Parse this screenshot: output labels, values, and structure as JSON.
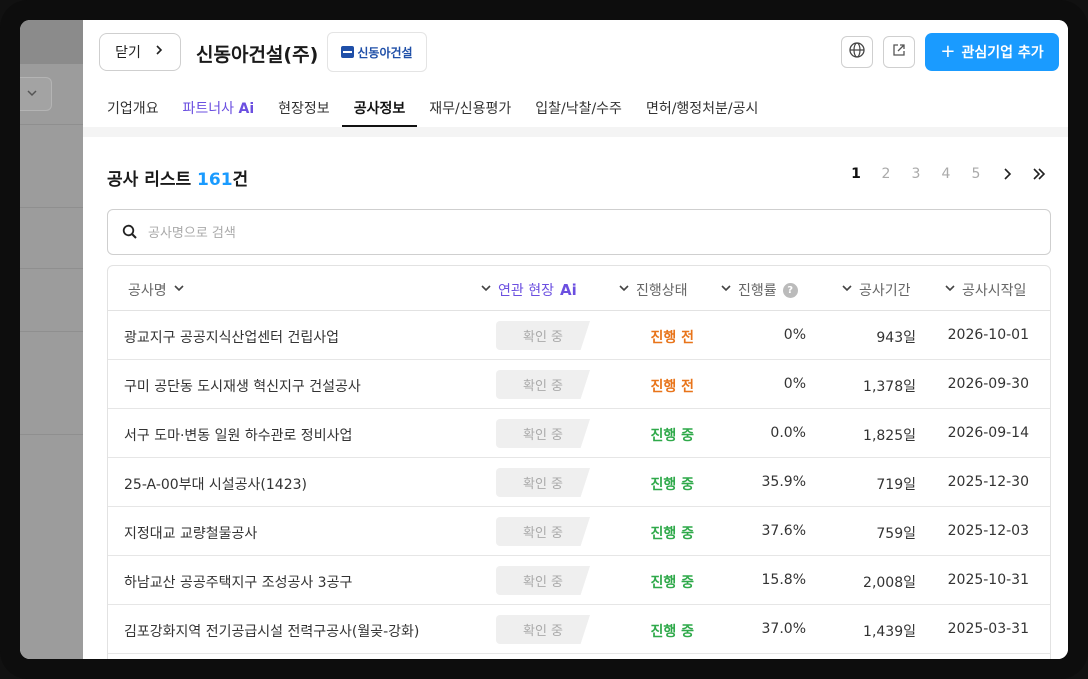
{
  "header": {
    "close_label": "닫기",
    "company_name": "신동아건설(주)",
    "logo_text": "신동아건설",
    "add_label": "관심기업 추가"
  },
  "tabs": [
    {
      "label": "기업개요"
    },
    {
      "label": "파트너사",
      "suffix": "Ai"
    },
    {
      "label": "현장정보"
    },
    {
      "label": "공사정보",
      "active": true
    },
    {
      "label": "재무/신용평가"
    },
    {
      "label": "입찰/낙찰/수주"
    },
    {
      "label": "면허/행정처분/공시"
    }
  ],
  "list": {
    "title": "공사 리스트",
    "count": "161",
    "count_suffix": "건"
  },
  "pagination": {
    "pages": [
      "1",
      "2",
      "3",
      "4",
      "5"
    ],
    "current": "1"
  },
  "search": {
    "placeholder": "공사명으로 검색",
    "value": ""
  },
  "columns": {
    "name": "공사명",
    "related": "연관 현장",
    "related_suffix": "Ai",
    "status": "진행상태",
    "rate": "진행률",
    "period": "공사기간",
    "start": "공사시작일"
  },
  "rows": [
    {
      "name": "광교지구 공공지식산업센터 건립사업",
      "confirm": "확인 중",
      "status": "진행 전",
      "rate": "0%",
      "period": "943일",
      "start": "2026-10-01"
    },
    {
      "name": "구미 공단동 도시재생 혁신지구 건설공사",
      "confirm": "확인 중",
      "status": "진행 전",
      "rate": "0%",
      "period": "1,378일",
      "start": "2026-09-30"
    },
    {
      "name": "서구 도마·변동 일원 하수관로 정비사업",
      "confirm": "확인 중",
      "status": "진행 중",
      "rate": "0.0%",
      "period": "1,825일",
      "start": "2026-09-14"
    },
    {
      "name": "25-A-00부대 시설공사(1423)",
      "confirm": "확인 중",
      "status": "진행 중",
      "rate": "35.9%",
      "period": "719일",
      "start": "2025-12-30"
    },
    {
      "name": "지정대교 교량철물공사",
      "confirm": "확인 중",
      "status": "진행 중",
      "rate": "37.6%",
      "period": "759일",
      "start": "2025-12-03"
    },
    {
      "name": "하남교산 공공주택지구 조성공사 3공구",
      "confirm": "확인 중",
      "status": "진행 중",
      "rate": "15.8%",
      "period": "2,008일",
      "start": "2025-10-31"
    },
    {
      "name": "김포강화지역 전기공급시설 전력구공사(월곶-강화)",
      "confirm": "확인 중",
      "status": "진행 중",
      "rate": "37.0%",
      "period": "1,439일",
      "start": "2025-03-31"
    }
  ],
  "colors": {
    "accent": "#1a9bff",
    "ai_purple": "#6b4fe0",
    "status_before": "#e8741a",
    "status_ongoing": "#2fa94a"
  }
}
